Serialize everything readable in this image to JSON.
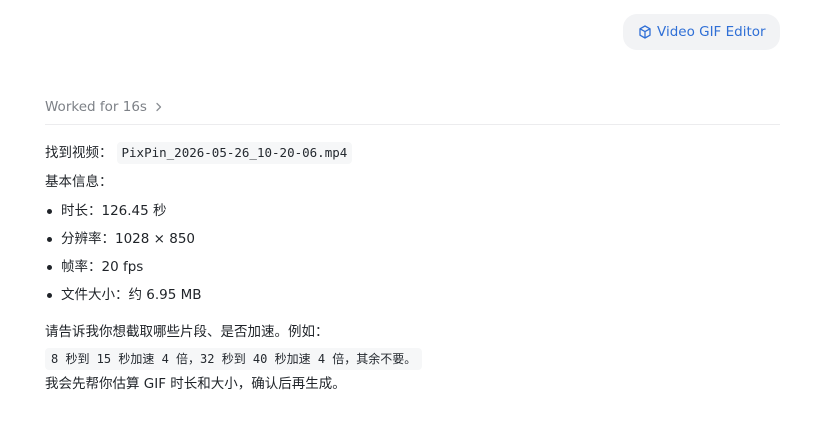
{
  "skill_chip": {
    "label": "Video GIF Editor",
    "icon": "cube-icon",
    "accent": "#2f6fd6"
  },
  "activity": {
    "label": "Worked for 16s",
    "icon": "chevron-right-icon"
  },
  "message": {
    "found_prefix": "找到视频：",
    "found_file": "PixPin_2026-05-26_10-20-06.mp4",
    "info_heading": "基本信息：",
    "info_items": [
      "时长：126.45 秒",
      "分辨率：1028 × 850",
      "帧率：20 fps",
      "文件大小：约 6.95 MB"
    ],
    "ask": "请告诉我你想截取哪些片段、是否加速。例如：",
    "example": "8 秒到 15 秒加速 4 倍，32 秒到 40 秒加速 4 倍，其余不要。",
    "closing": "我会先帮你估算 GIF 时长和大小，确认后再生成。"
  }
}
